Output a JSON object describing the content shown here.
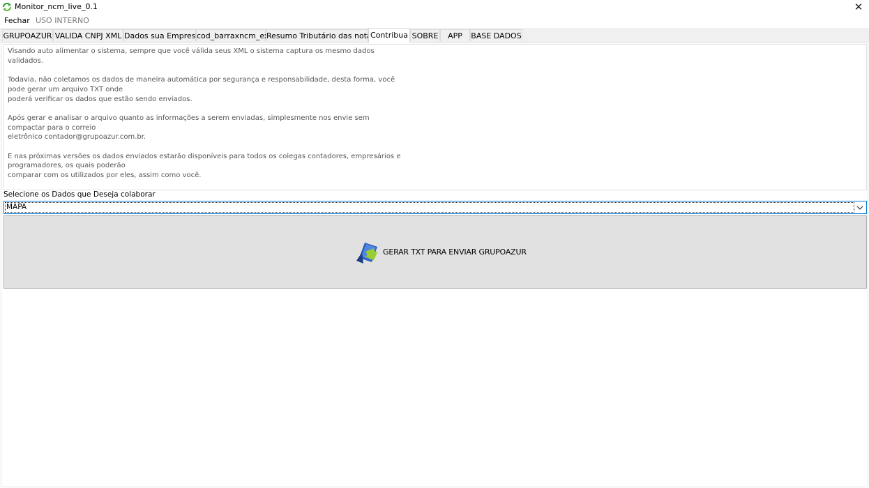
{
  "window": {
    "title": "Monitor_ncm_live_0.1",
    "icon": "recycle-arrows-icon",
    "close_glyph": "✕"
  },
  "menu": {
    "items": [
      "Fechar",
      "USO INTERNO"
    ]
  },
  "tabs": [
    {
      "label": "GRUPOAZUR"
    },
    {
      "label": "VALIDA CNPJ XML"
    },
    {
      "label": "Dados sua Empresa"
    },
    {
      "label": "cod_barraxncm_ex"
    },
    {
      "label": "Resumo Tributário das notas"
    },
    {
      "label": "Contribua"
    },
    {
      "label": "SOBRE"
    },
    {
      "label": "APP"
    },
    {
      "label": "BASE DADOS"
    }
  ],
  "active_tab": "Contribua",
  "contribua": {
    "description": "Visando auto alimentar o sistema, sempre que você válida seus XML o sistema captura os mesmo dados\nvalidados.\n\nTodavia, não coletamos os dados de maneira automática por segurança e responsabilidade, desta forma, você\npode gerar um arquivo TXT onde\npoderá verificar os dados que estão sendo enviados.\n\nApós gerar e analisar o arquivo quanto as informações a serem enviadas, simplesmente nos envie sem\ncompactar para o correio\neletrônico contador@grupoazur.com.br.\n\nE nas próximas versões os dados enviados estarão disponíveis para todos os colegas contadores, empresários e\nprogramadores, os quais poderão\ncomparar com os utilizados por eles, assim como você.",
    "select_label": "Selecione os Dados que Deseja colaborar",
    "select_value": "MAPA",
    "button_label": "GERAR TXT PARA ENVIAR GRUPOAZUR",
    "button_icon": "export-file-icon"
  },
  "colors": {
    "focus_border": "#0078d7",
    "button_face": "#e1e1e1",
    "tab_strip": "#f0f0f0"
  }
}
